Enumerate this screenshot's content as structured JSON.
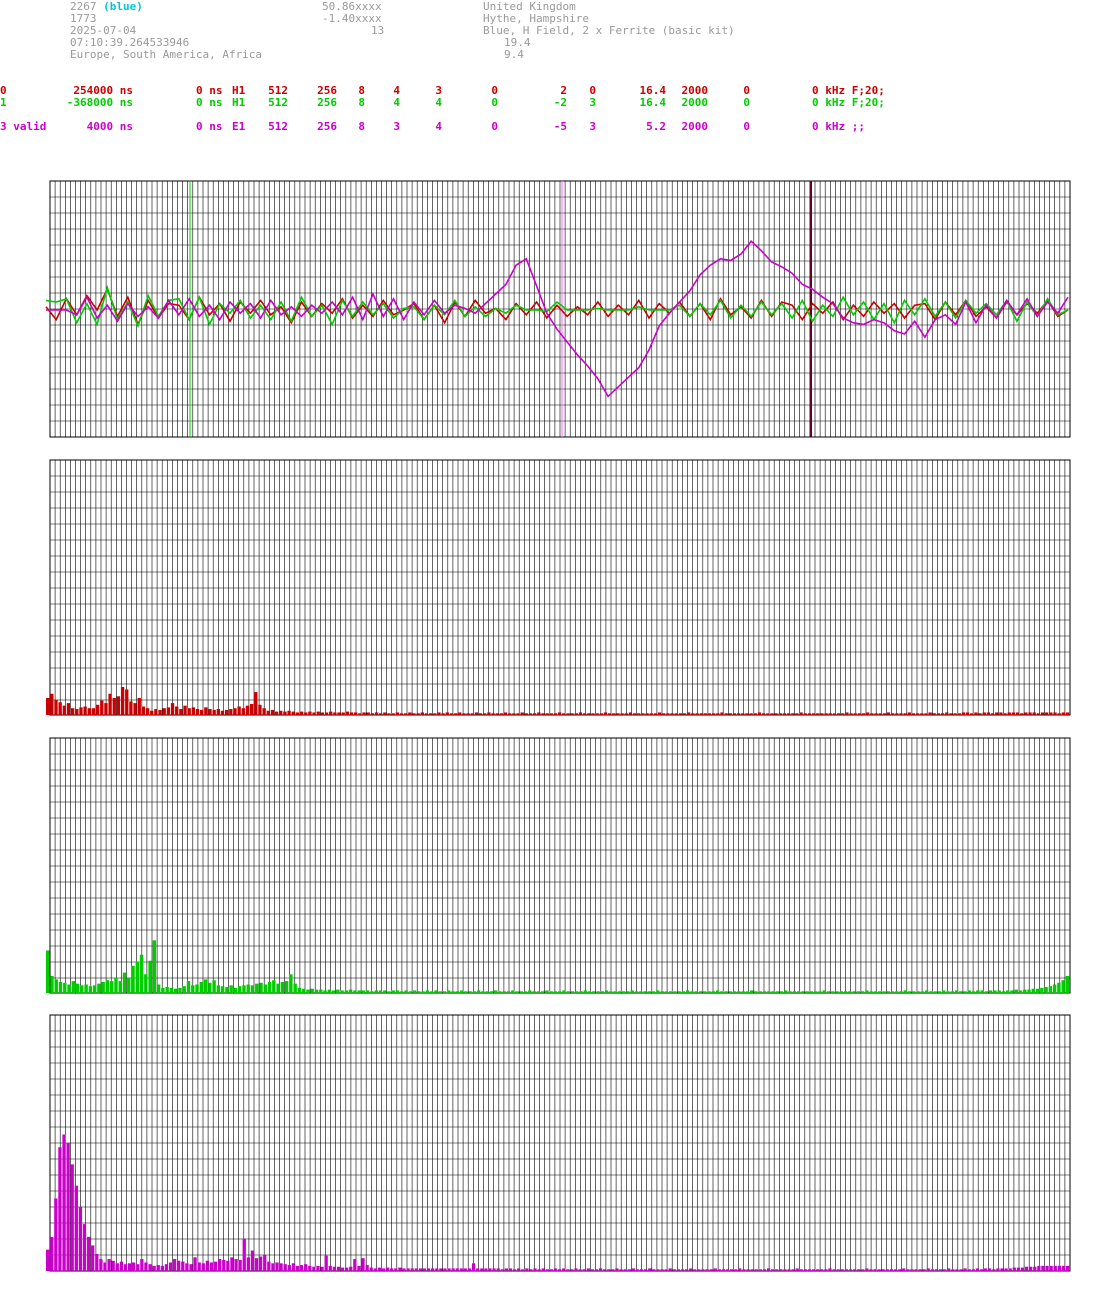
{
  "header": {
    "station_id": "2267",
    "station_color": "(blue)",
    "line2": "1773",
    "date": "2025-07-04",
    "time": "07:10:39.264533946",
    "region": "Europe, South America, Africa",
    "lat": "50.86xxxx",
    "lon": "-1.40xxxx",
    "num": "13",
    "country": "United Kingdom",
    "place": "Hythe, Hampshire",
    "equipment": "Blue, H Field, 2 x Ferrite (basic kit)",
    "val1": "19.4",
    "val2": "9.4"
  },
  "channels": [
    {
      "id": "0",
      "offset": "254000 ns",
      "delay": "0 ns",
      "type": "H1",
      "c1": "512",
      "c2": "256",
      "c3": "8",
      "c4": "4",
      "c5": "3",
      "c6": "0",
      "c7": "2",
      "c8": "0",
      "freq": "16.4",
      "c9": "2000",
      "c10": "0",
      "tail": "0 kHz F;20;",
      "color": "#cc0000"
    },
    {
      "id": "1",
      "offset": "-368000 ns",
      "delay": "0 ns",
      "type": "H1",
      "c1": "512",
      "c2": "256",
      "c3": "8",
      "c4": "4",
      "c5": "4",
      "c6": "0",
      "c7": "-2",
      "c8": "3",
      "freq": "16.4",
      "c9": "2000",
      "c10": "0",
      "tail": "0 kHz F;20;",
      "color": "#00cc00"
    },
    {
      "id": "3 valid",
      "offset": "4000 ns",
      "delay": "0 ns",
      "type": "E1",
      "c1": "512",
      "c2": "256",
      "c3": "8",
      "c4": "3",
      "c5": "4",
      "c6": "0",
      "c7": "-5",
      "c8": "3",
      "freq": "5.2",
      "c9": "2000",
      "c10": "0",
      "tail": "0 kHz ;;",
      "color": "#cc00cc"
    }
  ],
  "chart_data": [
    {
      "type": "line",
      "title": "",
      "x": [
        0,
        1,
        2,
        3,
        4,
        5,
        6,
        7,
        8,
        9,
        10,
        11,
        12,
        13,
        14,
        15,
        16,
        17,
        18,
        19,
        20,
        21,
        22,
        23,
        24,
        25,
        26,
        27,
        28,
        29,
        30,
        31,
        32,
        33,
        34,
        35,
        36,
        37,
        38,
        39,
        40,
        41,
        42,
        43,
        44,
        45,
        46,
        47,
        48,
        49,
        50,
        51,
        52,
        53,
        54,
        55,
        56,
        57,
        58,
        59,
        60,
        61,
        62,
        63,
        64,
        65,
        66,
        67,
        68,
        69,
        70,
        71,
        72,
        73,
        74,
        75,
        76,
        77,
        78,
        79,
        80,
        81,
        82,
        83,
        84,
        85,
        86,
        87,
        88,
        89,
        90,
        91,
        92,
        93,
        94,
        95,
        96,
        97,
        98,
        99,
        100
      ],
      "ylim": [
        -8,
        8
      ],
      "series": [
        {
          "color": "#cc0000",
          "values": [
            0.2,
            -0.6,
            0.7,
            -0.3,
            0.9,
            0.0,
            1.3,
            -0.4,
            0.8,
            -0.9,
            0.6,
            -0.5,
            0.4,
            0.3,
            -0.6,
            0.8,
            -0.3,
            0.4,
            -0.7,
            0.5,
            -0.2,
            0.6,
            -0.3,
            0.2,
            -0.8,
            0.5,
            -0.4,
            0.4,
            -0.2,
            0.7,
            -0.5,
            0.3,
            -0.4,
            0.6,
            -0.3,
            0.0,
            0.4,
            -0.6,
            0.3,
            -0.8,
            0.5,
            -0.4,
            0.6,
            -0.2,
            0.1,
            -0.6,
            0.4,
            -0.3,
            0.5,
            -0.5,
            0.3,
            -0.4,
            0.2,
            -0.3,
            0.5,
            -0.4,
            0.3,
            -0.3,
            0.6,
            -0.5,
            0.4,
            -0.2,
            0.5,
            -0.4,
            0.4,
            -0.6,
            0.7,
            -0.3,
            0.2,
            -0.5,
            0.6,
            -0.4,
            0.5,
            0.3,
            -0.6,
            0.4,
            -0.2,
            0.5,
            -0.6,
            0.3,
            -0.4,
            0.5,
            -0.2,
            0.4,
            -0.5,
            0.3,
            0.4,
            -0.6,
            0.5,
            -0.3,
            0.6,
            -0.4,
            0.2,
            -0.5,
            0.5,
            -0.3,
            0.4,
            -0.2,
            0.6,
            -0.4,
            0.0
          ]
        },
        {
          "color": "#00cc00",
          "values": [
            0.6,
            0.5,
            0.7,
            -0.8,
            0.4,
            -0.9,
            1.4,
            -0.6,
            0.5,
            -1.0,
            0.9,
            -0.4,
            0.6,
            0.7,
            -0.6,
            0.8,
            -0.9,
            0.4,
            -0.2,
            0.6,
            -0.5,
            0.3,
            -0.6,
            0.5,
            -0.7,
            0.8,
            -0.4,
            0.3,
            -0.9,
            0.6,
            -0.4,
            0.5,
            -0.3,
            0.4,
            -0.5,
            0.1,
            0.2,
            -0.6,
            0.3,
            -0.3,
            0.6,
            -0.4,
            0.2,
            -0.4,
            0.1,
            -0.2,
            0.3,
            0.0,
            0.0,
            -0.1,
            0.5,
            0.0,
            0.0,
            0.0,
            0.1,
            0.0,
            0.0,
            0.0,
            0.2,
            0.0,
            0.0,
            0.0,
            0.3,
            -0.4,
            0.4,
            -0.3,
            0.6,
            -0.5,
            0.3,
            -0.4,
            0.5,
            -0.3,
            0.4,
            -0.5,
            0.6,
            -0.7,
            0.3,
            -0.4,
            0.8,
            -0.3,
            0.5,
            -0.6,
            0.4,
            -0.8,
            0.6,
            -0.3,
            0.7,
            -0.4,
            0.5,
            -0.5,
            0.6,
            -0.2,
            0.4,
            -0.3,
            0.6,
            -0.7,
            0.5,
            -0.4,
            0.7,
            -0.3,
            0.0
          ]
        },
        {
          "color": "#cc00cc",
          "values": [
            0.0,
            0.0,
            0.0,
            -0.3,
            0.8,
            -0.5,
            0.3,
            -0.7,
            0.4,
            -0.4,
            0.2,
            -0.5,
            0.6,
            -0.3,
            0.7,
            -0.4,
            0.3,
            -0.6,
            0.5,
            -0.2,
            0.4,
            -0.5,
            0.6,
            -0.3,
            0.2,
            -0.4,
            0.3,
            -0.2,
            0.5,
            -0.3,
            0.8,
            -0.6,
            1.0,
            -0.4,
            0.7,
            -0.6,
            0.5,
            -0.3,
            0.6,
            -0.2,
            0.3,
            0.1,
            -0.2,
            0.4,
            1.0,
            1.6,
            2.8,
            3.2,
            1.5,
            -0.2,
            -1.2,
            -2.0,
            -2.8,
            -3.5,
            -4.3,
            -5.4,
            -4.8,
            -4.2,
            -3.6,
            -2.5,
            -1.0,
            -0.2,
            0.5,
            1.2,
            2.2,
            2.8,
            3.2,
            3.1,
            3.5,
            4.3,
            3.7,
            3.0,
            2.7,
            2.3,
            1.6,
            1.3,
            0.8,
            0.4,
            -0.5,
            -0.8,
            -0.9,
            -0.6,
            -0.8,
            -1.3,
            -1.5,
            -0.7,
            -1.7,
            -0.6,
            -0.3,
            -0.9,
            0.5,
            -0.8,
            0.3,
            -0.5,
            0.6,
            -0.3,
            0.7,
            -0.4,
            0.5,
            -0.2,
            0.8
          ]
        }
      ]
    },
    {
      "type": "bar",
      "title": "",
      "ylim": [
        0,
        30
      ],
      "values": [
        2.0,
        2.5,
        1.8,
        1.5,
        1.1,
        1.4,
        0.8,
        0.7,
        0.9,
        1.0,
        0.8,
        0.8,
        1.2,
        1.7,
        1.4,
        2.5,
        2.0,
        2.2,
        3.3,
        3.0,
        1.6,
        1.4,
        2.0,
        1.0,
        0.8,
        0.5,
        0.7,
        0.6,
        0.8,
        0.9,
        1.4,
        1.0,
        0.7,
        1.1,
        0.8,
        0.9,
        0.7,
        0.6,
        0.9,
        0.7,
        0.6,
        0.7,
        0.5,
        0.6,
        0.7,
        0.8,
        1.0,
        0.8,
        1.1,
        1.3,
        2.7,
        1.2,
        0.8,
        0.5,
        0.6,
        0.4,
        0.5,
        0.4,
        0.5,
        0.4,
        0.3,
        0.4,
        0.3,
        0.4,
        0.3,
        0.4,
        0.3,
        0.3,
        0.4,
        0.3,
        0.3,
        0.3,
        0.4,
        0.3,
        0.3,
        0.2,
        0.3,
        0.3,
        0.2,
        0.3,
        0.2,
        0.3,
        0.2,
        0.2,
        0.3,
        0.2,
        0.2,
        0.3,
        0.2,
        0.2,
        0.3,
        0.2,
        0.2,
        0.2,
        0.3,
        0.2,
        0.3,
        0.2,
        0.2,
        0.3,
        0.2,
        0.2,
        0.2,
        0.3,
        0.2,
        0.2,
        0.3,
        0.2,
        0.2,
        0.2,
        0.3,
        0.2,
        0.2,
        0.2,
        0.3,
        0.2,
        0.2,
        0.2,
        0.3,
        0.2,
        0.2,
        0.2,
        0.2,
        0.3,
        0.2,
        0.2,
        0.2,
        0.2,
        0.3,
        0.2,
        0.2,
        0.2,
        0.2,
        0.2,
        0.3,
        0.2,
        0.2,
        0.2,
        0.2,
        0.2,
        0.3,
        0.2,
        0.2,
        0.2,
        0.2,
        0.2,
        0.2,
        0.3,
        0.2,
        0.2,
        0.2,
        0.2,
        0.2,
        0.2,
        0.3,
        0.2,
        0.2,
        0.2,
        0.2,
        0.2,
        0.2,
        0.2,
        0.3,
        0.2,
        0.2,
        0.2,
        0.2,
        0.2,
        0.2,
        0.2,
        0.2,
        0.3,
        0.2,
        0.2,
        0.2,
        0.2,
        0.2,
        0.2,
        0.2,
        0.2,
        0.2,
        0.3,
        0.2,
        0.2,
        0.2,
        0.2,
        0.2,
        0.2,
        0.2,
        0.2,
        0.2,
        0.2,
        0.3,
        0.2,
        0.2,
        0.2,
        0.2,
        0.3,
        0.2,
        0.2,
        0.2,
        0.2,
        0.3,
        0.2,
        0.2,
        0.2,
        0.2,
        0.3,
        0.2,
        0.2,
        0.2,
        0.2,
        0.3,
        0.2,
        0.2,
        0.2,
        0.3,
        0.2,
        0.2,
        0.2,
        0.3,
        0.3,
        0.2,
        0.3,
        0.2,
        0.3,
        0.3,
        0.2,
        0.3,
        0.3,
        0.2,
        0.3,
        0.3,
        0.3,
        0.2,
        0.3,
        0.3,
        0.3,
        0.2,
        0.3,
        0.3,
        0.3,
        0.3,
        0.2,
        0.3,
        0.3
      ],
      "color": "#cc0000"
    },
    {
      "type": "bar",
      "title": "",
      "ylim": [
        0,
        30
      ],
      "values": [
        5.0,
        2.0,
        1.6,
        1.3,
        1.2,
        1.0,
        1.4,
        1.1,
        0.9,
        1.0,
        0.8,
        0.9,
        1.1,
        1.3,
        1.5,
        1.4,
        1.8,
        1.4,
        2.4,
        1.8,
        3.2,
        3.7,
        4.5,
        2.2,
        3.8,
        6.2,
        1.0,
        0.6,
        0.7,
        0.6,
        0.5,
        0.6,
        0.8,
        1.4,
        0.9,
        1.0,
        1.3,
        1.6,
        1.2,
        1.5,
        0.9,
        0.8,
        0.7,
        0.9,
        0.6,
        0.8,
        0.9,
        1.0,
        0.9,
        1.1,
        1.2,
        1.0,
        1.3,
        1.5,
        1.1,
        1.3,
        1.4,
        2.2,
        1.1,
        0.6,
        0.5,
        0.4,
        0.5,
        0.4,
        0.4,
        0.3,
        0.4,
        0.3,
        0.4,
        0.3,
        0.3,
        0.4,
        0.3,
        0.3,
        0.3,
        0.3,
        0.2,
        0.3,
        0.3,
        0.3,
        0.2,
        0.3,
        0.3,
        0.2,
        0.3,
        0.2,
        0.3,
        0.2,
        0.2,
        0.3,
        0.2,
        0.3,
        0.2,
        0.2,
        0.3,
        0.2,
        0.2,
        0.3,
        0.2,
        0.2,
        0.2,
        0.3,
        0.2,
        0.2,
        0.2,
        0.3,
        0.2,
        0.2,
        0.2,
        0.3,
        0.2,
        0.2,
        0.2,
        0.3,
        0.2,
        0.2,
        0.2,
        0.3,
        0.2,
        0.2,
        0.2,
        0.3,
        0.2,
        0.2,
        0.2,
        0.2,
        0.3,
        0.2,
        0.2,
        0.2,
        0.2,
        0.3,
        0.2,
        0.2,
        0.2,
        0.2,
        0.2,
        0.3,
        0.2,
        0.2,
        0.2,
        0.2,
        0.2,
        0.3,
        0.2,
        0.2,
        0.2,
        0.2,
        0.2,
        0.2,
        0.3,
        0.2,
        0.2,
        0.2,
        0.2,
        0.2,
        0.2,
        0.3,
        0.2,
        0.2,
        0.2,
        0.2,
        0.2,
        0.2,
        0.2,
        0.3,
        0.2,
        0.2,
        0.2,
        0.2,
        0.2,
        0.2,
        0.2,
        0.3,
        0.2,
        0.2,
        0.2,
        0.2,
        0.2,
        0.2,
        0.2,
        0.2,
        0.3,
        0.2,
        0.2,
        0.2,
        0.2,
        0.2,
        0.2,
        0.2,
        0.2,
        0.2,
        0.3,
        0.2,
        0.2,
        0.2,
        0.2,
        0.2,
        0.2,
        0.2,
        0.2,
        0.3,
        0.2,
        0.2,
        0.2,
        0.2,
        0.3,
        0.2,
        0.2,
        0.2,
        0.3,
        0.2,
        0.2,
        0.3,
        0.2,
        0.2,
        0.3,
        0.2,
        0.3,
        0.3,
        0.2,
        0.3,
        0.3,
        0.3,
        0.2,
        0.3,
        0.3,
        0.4,
        0.3,
        0.4,
        0.4,
        0.5,
        0.5,
        0.6,
        0.7,
        0.8,
        1.0,
        1.2,
        1.5,
        2.0
      ],
      "color": "#00cc00"
    },
    {
      "type": "bar",
      "title": "",
      "ylim": [
        0,
        30
      ],
      "values": [
        2.5,
        4.0,
        8.5,
        14.5,
        16.0,
        15.0,
        12.5,
        10.0,
        7.5,
        5.5,
        4.0,
        3.0,
        2.0,
        1.4,
        1.0,
        1.4,
        1.2,
        0.9,
        1.1,
        0.8,
        0.9,
        1.0,
        0.8,
        1.4,
        1.0,
        0.8,
        0.6,
        0.7,
        0.6,
        0.8,
        1.0,
        1.4,
        1.2,
        1.1,
        0.9,
        0.8,
        1.6,
        1.0,
        0.9,
        1.2,
        1.0,
        1.1,
        1.4,
        1.3,
        1.2,
        1.6,
        1.4,
        1.3,
        3.8,
        1.6,
        2.4,
        1.5,
        1.7,
        1.9,
        1.1,
        0.9,
        1.0,
        0.9,
        0.8,
        0.7,
        0.9,
        0.6,
        0.7,
        0.8,
        0.6,
        0.5,
        0.6,
        0.5,
        1.8,
        0.6,
        0.5,
        0.5,
        0.4,
        0.4,
        0.5,
        1.4,
        0.6,
        1.5,
        0.7,
        0.4,
        0.3,
        0.4,
        0.3,
        0.4,
        0.3,
        0.3,
        0.4,
        0.3,
        0.3,
        0.3,
        0.3,
        0.3,
        0.3,
        0.3,
        0.3,
        0.3,
        0.3,
        0.3,
        0.3,
        0.3,
        0.3,
        0.3,
        0.3,
        0.3,
        0.9,
        0.3,
        0.3,
        0.3,
        0.3,
        0.3,
        0.3,
        0.2,
        0.3,
        0.3,
        0.2,
        0.3,
        0.2,
        0.3,
        0.2,
        0.3,
        0.2,
        0.3,
        0.2,
        0.2,
        0.3,
        0.2,
        0.3,
        0.2,
        0.2,
        0.3,
        0.2,
        0.2,
        0.3,
        0.2,
        0.2,
        0.3,
        0.2,
        0.2,
        0.2,
        0.3,
        0.2,
        0.2,
        0.2,
        0.3,
        0.2,
        0.2,
        0.2,
        0.3,
        0.2,
        0.2,
        0.2,
        0.2,
        0.3,
        0.2,
        0.2,
        0.2,
        0.2,
        0.3,
        0.2,
        0.2,
        0.2,
        0.2,
        0.2,
        0.3,
        0.2,
        0.2,
        0.2,
        0.2,
        0.2,
        0.3,
        0.2,
        0.2,
        0.2,
        0.2,
        0.2,
        0.2,
        0.3,
        0.2,
        0.2,
        0.2,
        0.2,
        0.2,
        0.2,
        0.3,
        0.2,
        0.2,
        0.2,
        0.2,
        0.2,
        0.2,
        0.2,
        0.3,
        0.2,
        0.2,
        0.2,
        0.2,
        0.2,
        0.2,
        0.2,
        0.2,
        0.3,
        0.2,
        0.2,
        0.2,
        0.2,
        0.2,
        0.2,
        0.2,
        0.2,
        0.3,
        0.2,
        0.2,
        0.2,
        0.2,
        0.2,
        0.3,
        0.2,
        0.2,
        0.2,
        0.2,
        0.3,
        0.2,
        0.2,
        0.2,
        0.3,
        0.2,
        0.2,
        0.3,
        0.2,
        0.3,
        0.3,
        0.2,
        0.3,
        0.3,
        0.3,
        0.3,
        0.4,
        0.4,
        0.4,
        0.5,
        0.5,
        0.5,
        0.6,
        0.6,
        0.6,
        0.6,
        0.6,
        0.6,
        0.6,
        0.6
      ],
      "color": "#cc00cc"
    }
  ]
}
